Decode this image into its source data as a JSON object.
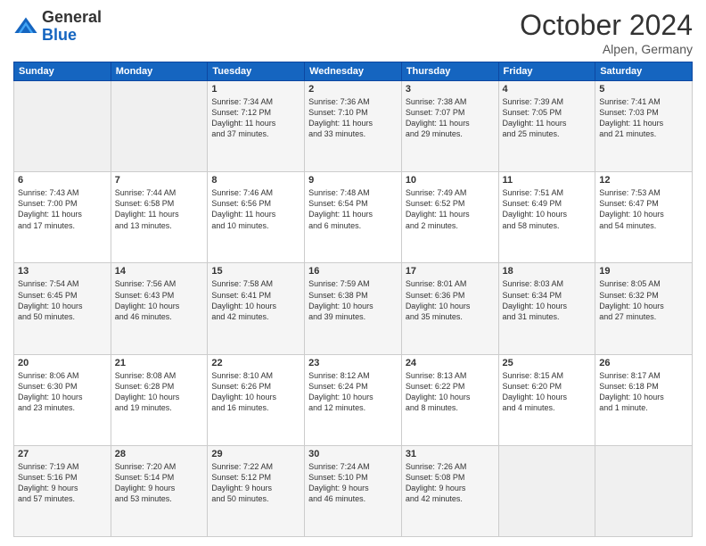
{
  "header": {
    "logo": {
      "line1": "General",
      "line2": "Blue"
    },
    "title": "October 2024",
    "location": "Alpen, Germany"
  },
  "weekdays": [
    "Sunday",
    "Monday",
    "Tuesday",
    "Wednesday",
    "Thursday",
    "Friday",
    "Saturday"
  ],
  "weeks": [
    [
      {
        "day": "",
        "info": ""
      },
      {
        "day": "",
        "info": ""
      },
      {
        "day": "1",
        "info": "Sunrise: 7:34 AM\nSunset: 7:12 PM\nDaylight: 11 hours\nand 37 minutes."
      },
      {
        "day": "2",
        "info": "Sunrise: 7:36 AM\nSunset: 7:10 PM\nDaylight: 11 hours\nand 33 minutes."
      },
      {
        "day": "3",
        "info": "Sunrise: 7:38 AM\nSunset: 7:07 PM\nDaylight: 11 hours\nand 29 minutes."
      },
      {
        "day": "4",
        "info": "Sunrise: 7:39 AM\nSunset: 7:05 PM\nDaylight: 11 hours\nand 25 minutes."
      },
      {
        "day": "5",
        "info": "Sunrise: 7:41 AM\nSunset: 7:03 PM\nDaylight: 11 hours\nand 21 minutes."
      }
    ],
    [
      {
        "day": "6",
        "info": "Sunrise: 7:43 AM\nSunset: 7:00 PM\nDaylight: 11 hours\nand 17 minutes."
      },
      {
        "day": "7",
        "info": "Sunrise: 7:44 AM\nSunset: 6:58 PM\nDaylight: 11 hours\nand 13 minutes."
      },
      {
        "day": "8",
        "info": "Sunrise: 7:46 AM\nSunset: 6:56 PM\nDaylight: 11 hours\nand 10 minutes."
      },
      {
        "day": "9",
        "info": "Sunrise: 7:48 AM\nSunset: 6:54 PM\nDaylight: 11 hours\nand 6 minutes."
      },
      {
        "day": "10",
        "info": "Sunrise: 7:49 AM\nSunset: 6:52 PM\nDaylight: 11 hours\nand 2 minutes."
      },
      {
        "day": "11",
        "info": "Sunrise: 7:51 AM\nSunset: 6:49 PM\nDaylight: 10 hours\nand 58 minutes."
      },
      {
        "day": "12",
        "info": "Sunrise: 7:53 AM\nSunset: 6:47 PM\nDaylight: 10 hours\nand 54 minutes."
      }
    ],
    [
      {
        "day": "13",
        "info": "Sunrise: 7:54 AM\nSunset: 6:45 PM\nDaylight: 10 hours\nand 50 minutes."
      },
      {
        "day": "14",
        "info": "Sunrise: 7:56 AM\nSunset: 6:43 PM\nDaylight: 10 hours\nand 46 minutes."
      },
      {
        "day": "15",
        "info": "Sunrise: 7:58 AM\nSunset: 6:41 PM\nDaylight: 10 hours\nand 42 minutes."
      },
      {
        "day": "16",
        "info": "Sunrise: 7:59 AM\nSunset: 6:38 PM\nDaylight: 10 hours\nand 39 minutes."
      },
      {
        "day": "17",
        "info": "Sunrise: 8:01 AM\nSunset: 6:36 PM\nDaylight: 10 hours\nand 35 minutes."
      },
      {
        "day": "18",
        "info": "Sunrise: 8:03 AM\nSunset: 6:34 PM\nDaylight: 10 hours\nand 31 minutes."
      },
      {
        "day": "19",
        "info": "Sunrise: 8:05 AM\nSunset: 6:32 PM\nDaylight: 10 hours\nand 27 minutes."
      }
    ],
    [
      {
        "day": "20",
        "info": "Sunrise: 8:06 AM\nSunset: 6:30 PM\nDaylight: 10 hours\nand 23 minutes."
      },
      {
        "day": "21",
        "info": "Sunrise: 8:08 AM\nSunset: 6:28 PM\nDaylight: 10 hours\nand 19 minutes."
      },
      {
        "day": "22",
        "info": "Sunrise: 8:10 AM\nSunset: 6:26 PM\nDaylight: 10 hours\nand 16 minutes."
      },
      {
        "day": "23",
        "info": "Sunrise: 8:12 AM\nSunset: 6:24 PM\nDaylight: 10 hours\nand 12 minutes."
      },
      {
        "day": "24",
        "info": "Sunrise: 8:13 AM\nSunset: 6:22 PM\nDaylight: 10 hours\nand 8 minutes."
      },
      {
        "day": "25",
        "info": "Sunrise: 8:15 AM\nSunset: 6:20 PM\nDaylight: 10 hours\nand 4 minutes."
      },
      {
        "day": "26",
        "info": "Sunrise: 8:17 AM\nSunset: 6:18 PM\nDaylight: 10 hours\nand 1 minute."
      }
    ],
    [
      {
        "day": "27",
        "info": "Sunrise: 7:19 AM\nSunset: 5:16 PM\nDaylight: 9 hours\nand 57 minutes."
      },
      {
        "day": "28",
        "info": "Sunrise: 7:20 AM\nSunset: 5:14 PM\nDaylight: 9 hours\nand 53 minutes."
      },
      {
        "day": "29",
        "info": "Sunrise: 7:22 AM\nSunset: 5:12 PM\nDaylight: 9 hours\nand 50 minutes."
      },
      {
        "day": "30",
        "info": "Sunrise: 7:24 AM\nSunset: 5:10 PM\nDaylight: 9 hours\nand 46 minutes."
      },
      {
        "day": "31",
        "info": "Sunrise: 7:26 AM\nSunset: 5:08 PM\nDaylight: 9 hours\nand 42 minutes."
      },
      {
        "day": "",
        "info": ""
      },
      {
        "day": "",
        "info": ""
      }
    ]
  ]
}
